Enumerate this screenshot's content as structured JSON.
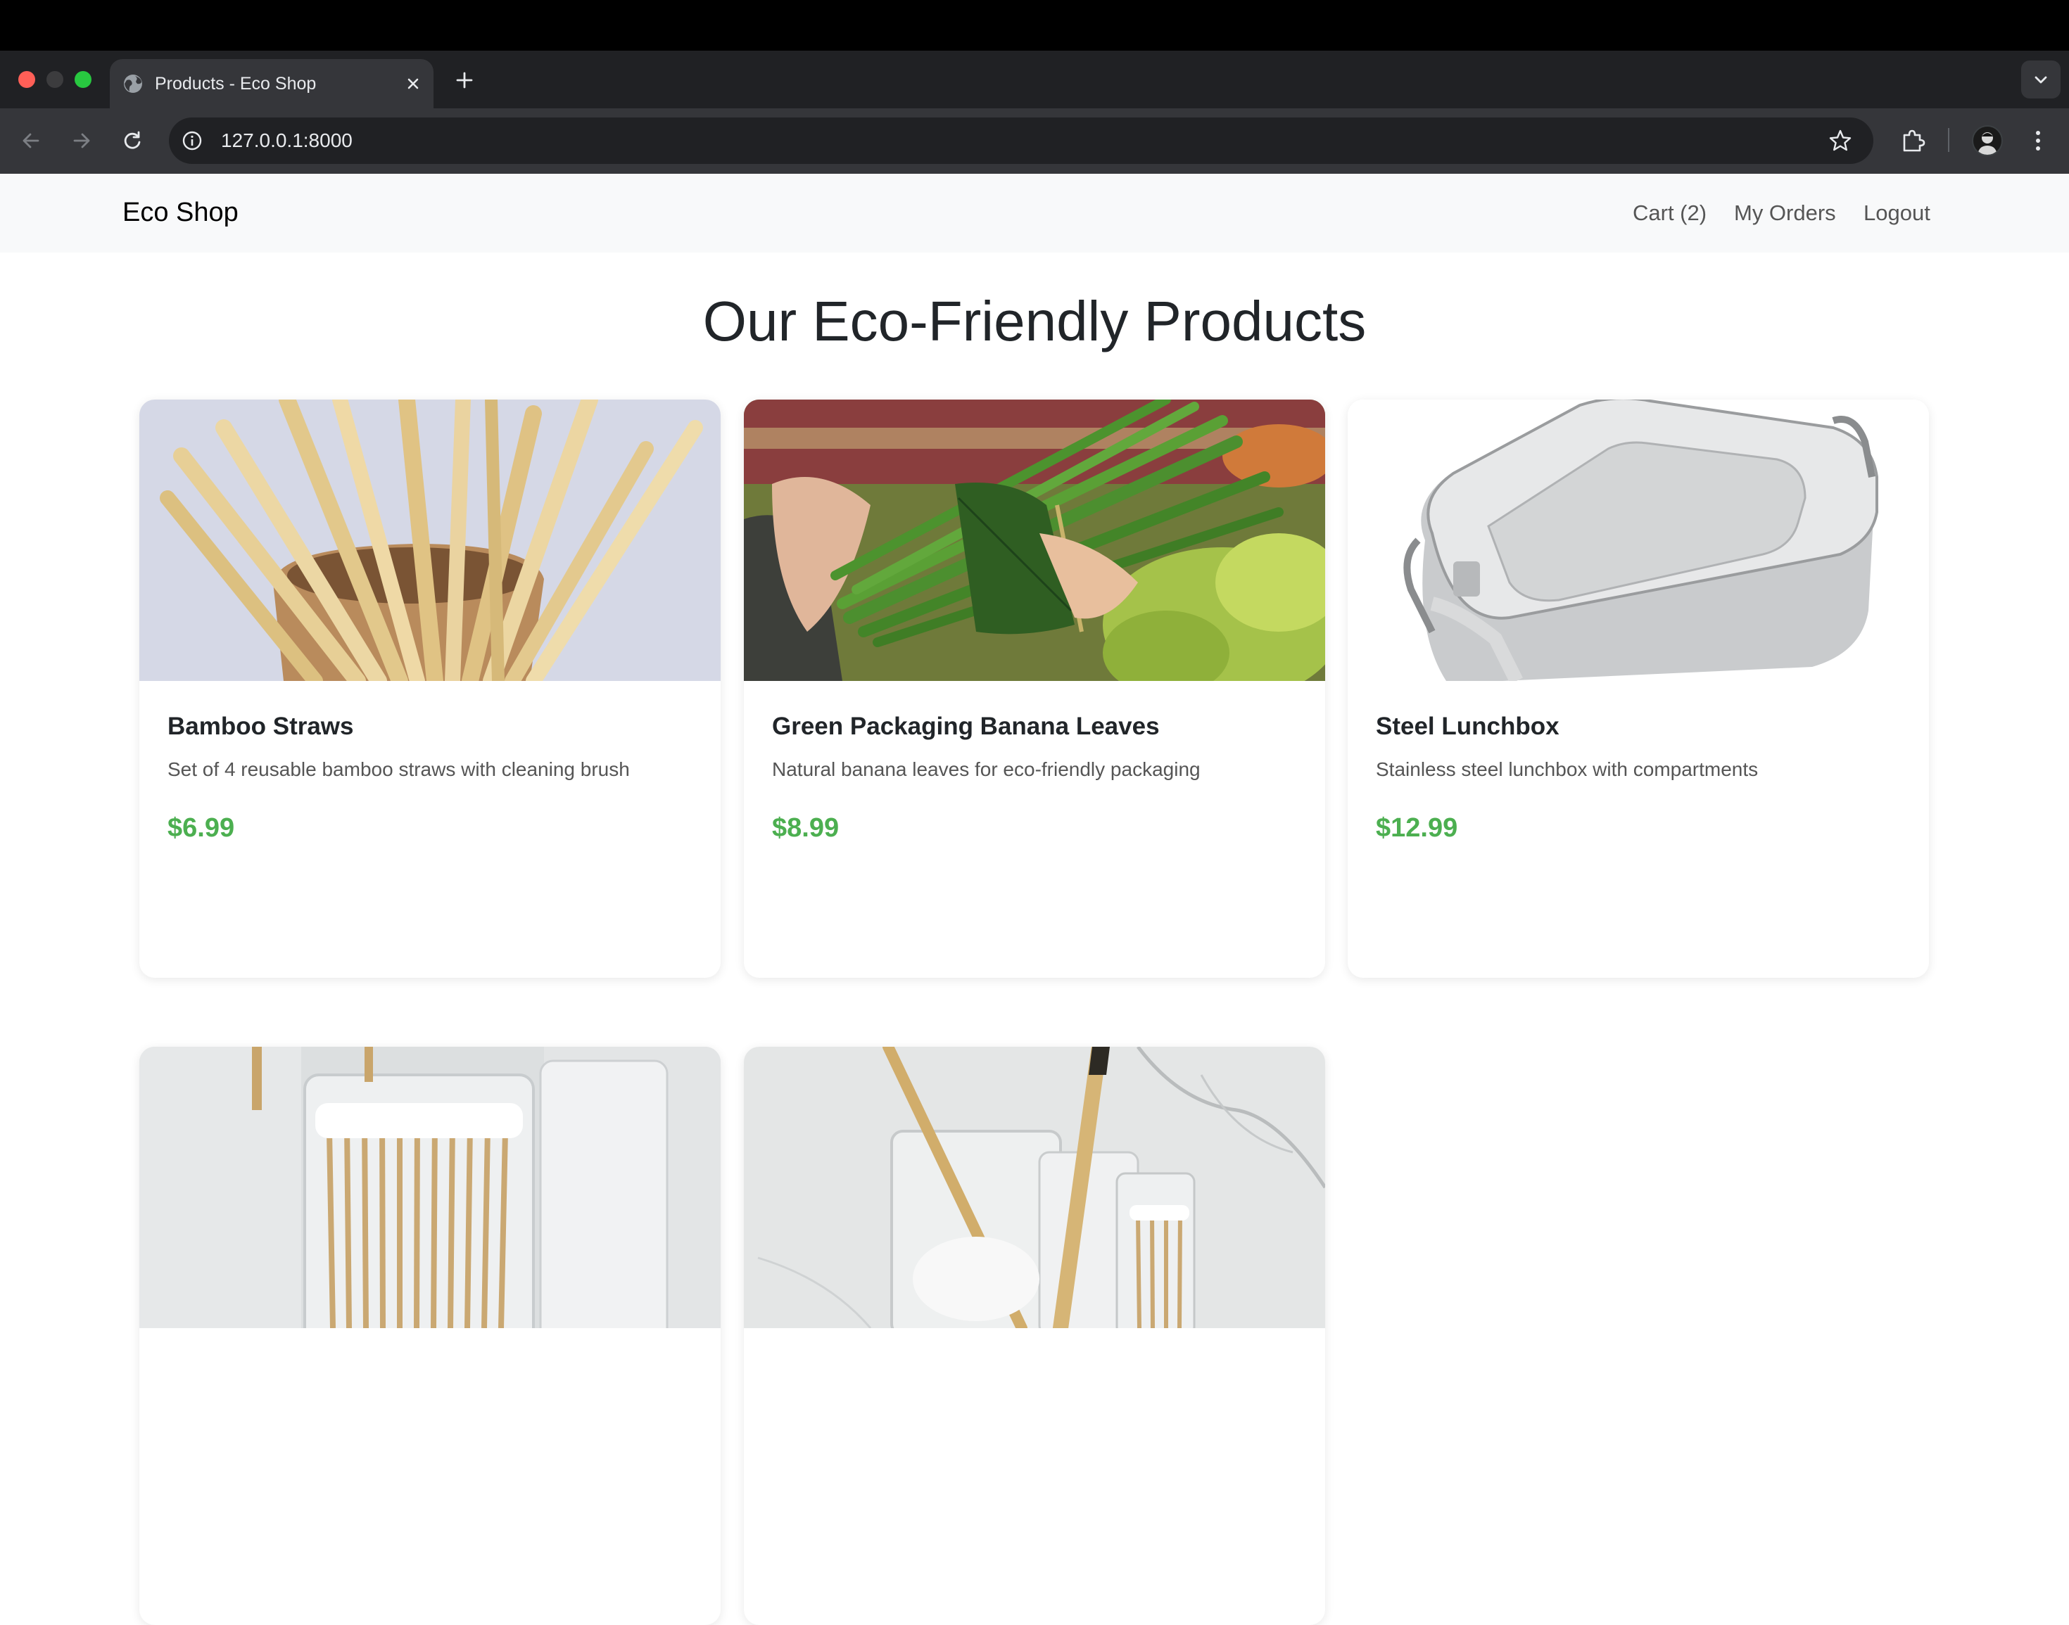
{
  "browser": {
    "tab_title": "Products - Eco Shop",
    "url": "127.0.0.1:8000"
  },
  "navbar": {
    "brand": "Eco Shop",
    "cart_label": "Cart (2)",
    "orders_label": "My Orders",
    "logout_label": "Logout"
  },
  "page": {
    "heading": "Our Eco-Friendly Products"
  },
  "products": [
    {
      "name": "Bamboo Straws",
      "description": "Set of 4 reusable bamboo straws with cleaning brush",
      "price": "$6.99",
      "image": "bamboo-straws-photo"
    },
    {
      "name": "Green Packaging Banana Leaves",
      "description": "Natural banana leaves for eco-friendly packaging",
      "price": "$8.99",
      "image": "banana-leaf-wrapped-beans-photo"
    },
    {
      "name": "Steel Lunchbox",
      "description": "Stainless steel lunchbox with compartments",
      "price": "$12.99",
      "image": "steel-lunchbox-photo"
    },
    {
      "image": "bamboo-cotton-swabs-photo"
    },
    {
      "image": "bamboo-toothbrush-holder-photo"
    }
  ],
  "colors": {
    "price_green": "#4caf50",
    "navbar_bg": "#f8f9fa",
    "chrome_dark": "#202124",
    "chrome_toolbar": "#35363a"
  },
  "icons": [
    "globe-icon",
    "close-icon",
    "plus-icon",
    "chevron-down-icon",
    "back-arrow-icon",
    "forward-arrow-icon",
    "reload-icon",
    "info-icon",
    "star-icon",
    "puzzle-icon",
    "avatar",
    "more-vert-icon"
  ]
}
